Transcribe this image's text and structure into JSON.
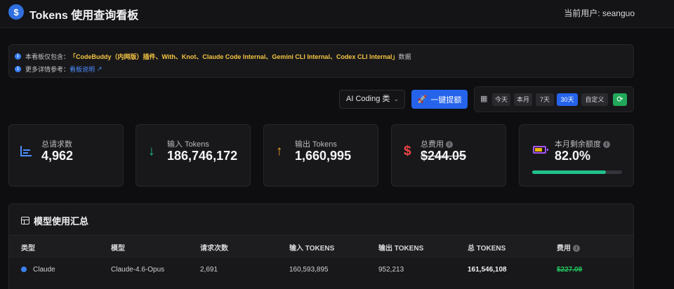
{
  "header": {
    "title": "Tokens 使用查询看板",
    "user_label": "当前用户: seanguo",
    "logo_glyph": "$"
  },
  "info": {
    "line1_prefix": "本看板仅包含：",
    "line1_highlight": "「CodeBuddy（内网版）插件、With、Knot、Claude Code Internal、Gemini CLI Internal、Codex CLI Internal」",
    "line1_suffix": "数据",
    "line2_prefix": "更多详情参考：",
    "line2_link": "看板说明"
  },
  "controls": {
    "category_select": "AI Coding 类",
    "one_click_button": "一键提额",
    "ranges": [
      "今天",
      "本月",
      "7天",
      "30天",
      "自定义"
    ],
    "active_range": "30天"
  },
  "stats": [
    {
      "label": "总请求数",
      "value": "4,962",
      "icon": "bar-chart-icon",
      "color": "#4c8dff"
    },
    {
      "label": "输入 Tokens",
      "value": "186,746,172",
      "icon": "arrow-down-icon",
      "color": "#22c08a"
    },
    {
      "label": "输出 Tokens",
      "value": "1,660,995",
      "icon": "arrow-up-icon",
      "color": "#f5a623"
    },
    {
      "label": "总费用",
      "value": "$244.05",
      "icon": "dollar-icon",
      "color": "#ef4444"
    },
    {
      "label": "本月剩余额度",
      "value": "82.0%",
      "icon": "battery-icon",
      "color": "#a855f7",
      "progress": 0.82
    }
  ],
  "table": {
    "title": "模型使用汇总",
    "headers": [
      "类型",
      "模型",
      "请求次数",
      "输入 TOKENS",
      "输出 TOKENS",
      "总 TOKENS",
      "费用"
    ],
    "rows": [
      {
        "type": "Claude",
        "model": "Claude-4.6-Opus",
        "requests": "2,691",
        "input": "160,593,895",
        "output": "952,213",
        "total": "161,546,108",
        "cost": "$227.09"
      }
    ]
  }
}
